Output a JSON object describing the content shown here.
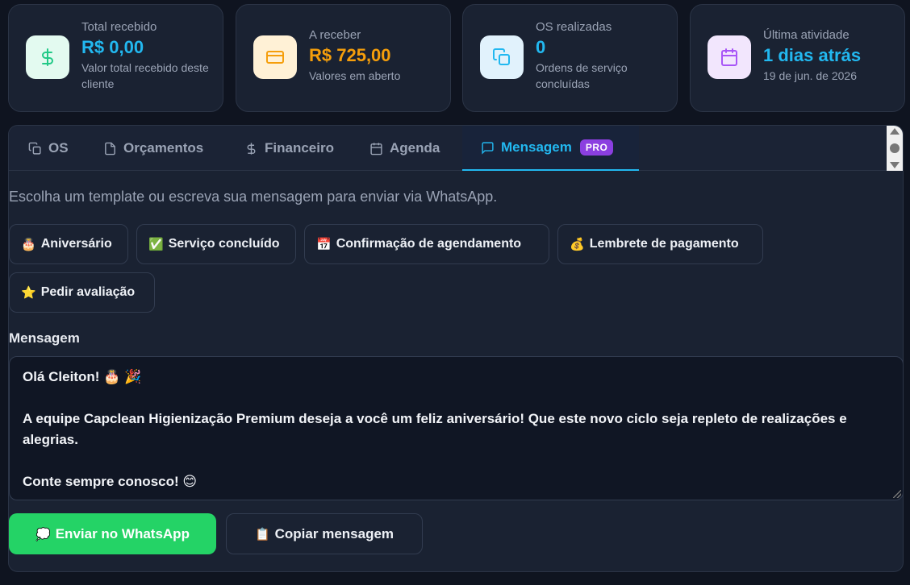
{
  "stats": [
    {
      "label": "Total recebido",
      "value": "R$ 0,00",
      "sub": "Valor total recebido deste cliente",
      "icon": "dollar-icon",
      "color": "#22c987",
      "bg": "#e3faf0"
    },
    {
      "label": "A receber",
      "value": "R$ 725,00",
      "sub": "Valores em aberto",
      "icon": "credit-card-icon",
      "color": "#f59e0b",
      "bg": "#fff1d6"
    },
    {
      "label": "OS realizadas",
      "value": "0",
      "sub": "Ordens de serviço concluídas",
      "icon": "copy-icon",
      "color": "#22b8f0",
      "bg": "#e1f2fc"
    },
    {
      "label": "Última atividade",
      "value": "1 dias atrás",
      "sub": "19 de jun. de 2026",
      "icon": "calendar-icon",
      "color": "#22b8f0",
      "bg": "#f2e6fd"
    }
  ],
  "tabs": [
    {
      "label": "OS",
      "icon": "copy-icon"
    },
    {
      "label": "Orçamentos",
      "icon": "file-icon"
    },
    {
      "label": "Financeiro",
      "icon": "dollar-icon"
    },
    {
      "label": "Agenda",
      "icon": "calendar-icon"
    },
    {
      "label": "Mensagem",
      "icon": "message-icon",
      "badge": "PRO",
      "active": true
    }
  ],
  "hint": "Escolha um template ou escreva sua mensagem para enviar via WhatsApp.",
  "templates": [
    {
      "emoji": "🎂",
      "label": "Aniversário"
    },
    {
      "emoji": "✅",
      "label": "Serviço concluído"
    },
    {
      "emoji": "📅",
      "label": "Confirmação de agendamento"
    },
    {
      "emoji": "💰",
      "label": "Lembrete de pagamento"
    },
    {
      "emoji": "⭐",
      "label": "Pedir avaliação"
    }
  ],
  "message": {
    "label": "Mensagem",
    "lines": [
      "Olá Cleiton! 🎂 🎉",
      "",
      "A equipe Capclean Higienização Premium deseja a você um feliz aniversário! Que este novo ciclo seja repleto de realizações e alegrias.",
      "",
      "Conte sempre conosco! 😊"
    ]
  },
  "actions": {
    "send_emoji": "💭",
    "send_label": "Enviar no WhatsApp",
    "copy_emoji": "📋",
    "copy_label": "Copiar mensagem"
  },
  "colors": {
    "accent": "#22b8f0",
    "whatsapp": "#24d366",
    "pro": "#8b3fe0"
  }
}
